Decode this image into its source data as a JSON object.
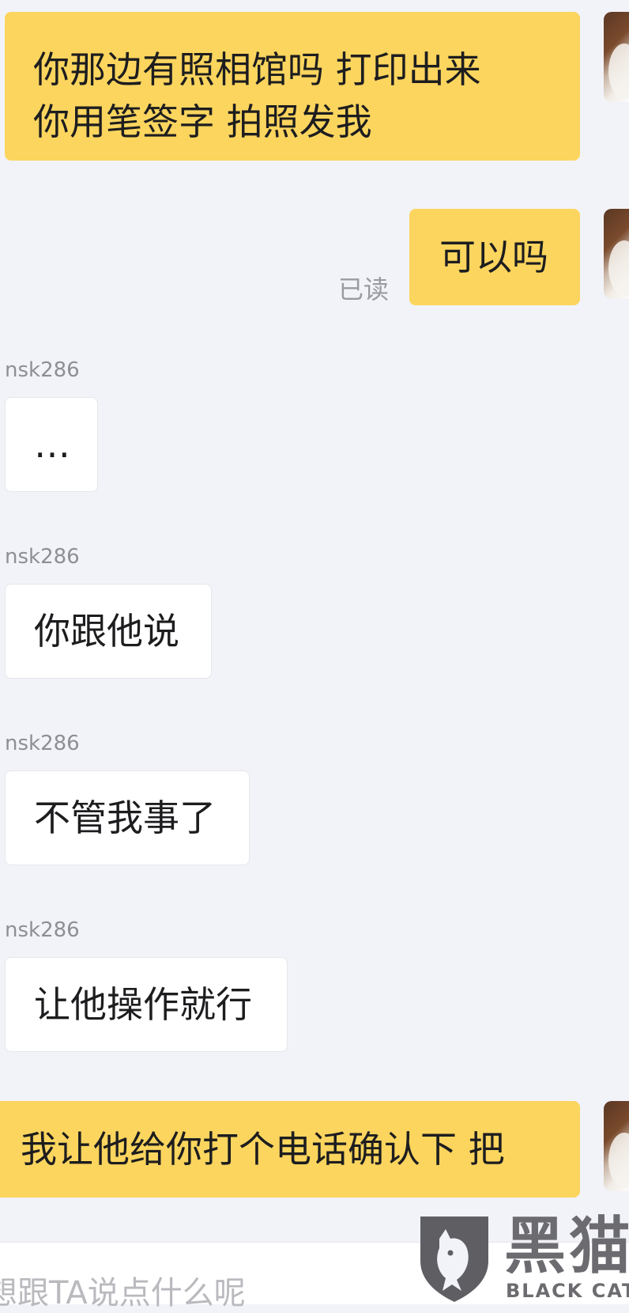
{
  "messages": [
    {
      "role": "me",
      "lines": [
        "你那边有照相馆吗  打印出来",
        "你用笔签字  拍照发我"
      ]
    },
    {
      "role": "me",
      "text": "可以吗",
      "status": "已读"
    },
    {
      "role": "other",
      "sender": "nsk286",
      "text": "…"
    },
    {
      "role": "other",
      "sender": "nsk286",
      "text": "你跟他说"
    },
    {
      "role": "other",
      "sender": "nsk286",
      "text": "不管我事了"
    },
    {
      "role": "other",
      "sender": "nsk286",
      "text": "让他操作就行"
    },
    {
      "role": "me",
      "text": "我让他给你打个电话确认下 把"
    }
  ],
  "input": {
    "placeholder": "想跟TA说点什么呢"
  },
  "watermark": {
    "cn": "黑猫",
    "en": "BLACK CAT"
  },
  "colors": {
    "my_bubble": "#fbd55e",
    "their_bubble": "#ffffff",
    "background": "#f2f3f8"
  }
}
